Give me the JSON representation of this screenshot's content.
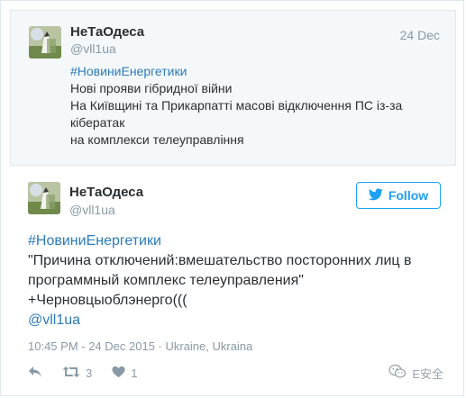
{
  "parent_tweet": {
    "name": "НеТаОдеса",
    "handle": "@vll1ua",
    "date": "24 Dec",
    "lines": [
      "#НовиниЕнергетики",
      "Нові прояви гібридної війни",
      "На Київщині та Прикарпатті масові відключення ПС із-за",
      "кібератак",
      "на комплекси телеуправління"
    ]
  },
  "main_tweet": {
    "name": "НеТаОдеса",
    "handle": "@vll1ua",
    "follow_label": "Follow",
    "lines": [
      "#НовиниЕнергетики",
      "\"Причина отключений:вмешательство посторонних лиц в",
      "программный комплекс телеуправления\"",
      "+Черновцыоблэнерго(((",
      "@vll1ua"
    ],
    "timestamp": "10:45 PM - 24 Dec 2015 · Ukraine, Ukraina",
    "retweet_count": "3",
    "like_count": "1"
  },
  "watermark": {
    "label": "E安全"
  },
  "colors": {
    "link": "#2b7bb9",
    "accent": "#1da1f2",
    "muted": "#8899a6"
  },
  "icons": [
    "reply-icon",
    "retweet-icon",
    "heart-icon",
    "twitter-bird-icon",
    "wechat-icon"
  ]
}
